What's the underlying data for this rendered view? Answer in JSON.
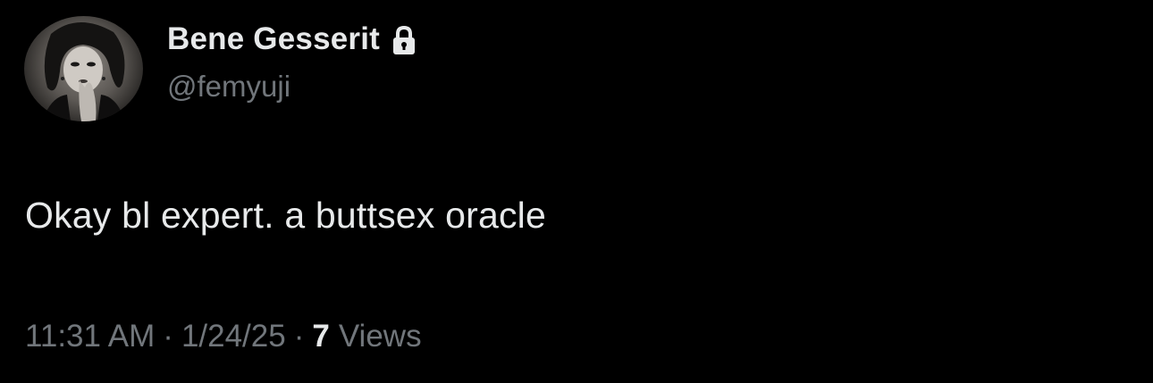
{
  "author": {
    "display_name": "Bene Gesserit",
    "handle": "@femyuji",
    "protected_icon": "lock-icon",
    "avatar": "profile-photo"
  },
  "tweet": {
    "text": "Okay bl expert. a buttsex oracle"
  },
  "meta": {
    "time": "11:31 AM",
    "separator": "·",
    "date": "1/24/25",
    "views_count": "7",
    "views_label": "Views"
  },
  "colors": {
    "background": "#000000",
    "primary_text": "#e7e9ea",
    "secondary_text": "#71767b"
  }
}
